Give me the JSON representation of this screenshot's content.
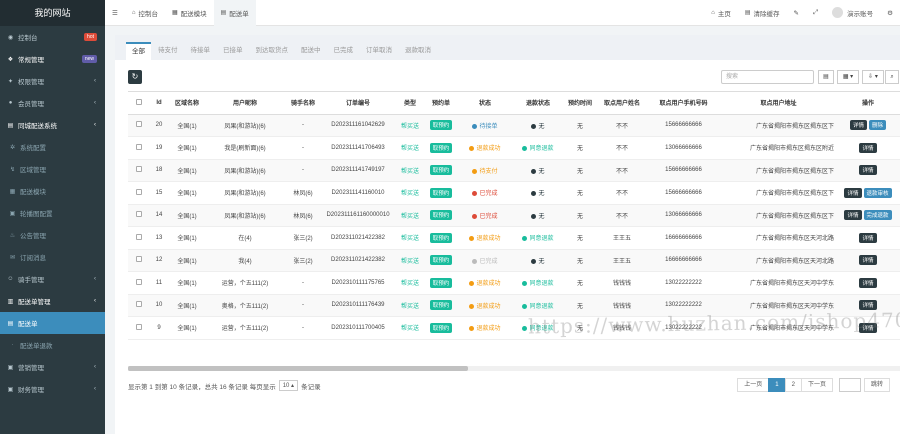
{
  "sidebar": {
    "logo": "我的网站",
    "items": [
      {
        "label": "控制台",
        "badge": "hot",
        "badge_color": "#dd4b39",
        "icon": "dashboard-icon",
        "glyph": "◉",
        "chevron": false,
        "active": false,
        "sub": false,
        "open": false
      },
      {
        "label": "常规管理",
        "badge": "new",
        "badge_color": "#605ca8",
        "icon": "cogs-icon",
        "glyph": "❖",
        "chevron": false,
        "active": false,
        "sub": false,
        "open": true
      },
      {
        "label": "权限管理",
        "badge": "",
        "icon": "group-icon",
        "glyph": "✦",
        "chevron": true,
        "active": false,
        "sub": false,
        "open": false
      },
      {
        "label": "会员管理",
        "badge": "",
        "icon": "user-icon",
        "glyph": "●",
        "chevron": true,
        "active": false,
        "sub": false,
        "open": false
      },
      {
        "label": "同城配送系统",
        "badge": "",
        "icon": "list-icon",
        "glyph": "▤",
        "chevron": true,
        "active": false,
        "sub": false,
        "open": true
      },
      {
        "label": "系统配置",
        "badge": "",
        "icon": "gear-icon",
        "glyph": "✲",
        "chevron": false,
        "active": false,
        "sub": true,
        "open": false
      },
      {
        "label": "区域管理",
        "badge": "",
        "icon": "location-icon",
        "glyph": "↯",
        "chevron": false,
        "active": false,
        "sub": true,
        "open": false
      },
      {
        "label": "配送模块",
        "badge": "",
        "icon": "module-icon",
        "glyph": "▦",
        "chevron": false,
        "active": false,
        "sub": true,
        "open": false
      },
      {
        "label": "轮播图配置",
        "badge": "",
        "icon": "image-icon",
        "glyph": "▣",
        "chevron": false,
        "active": false,
        "sub": true,
        "open": false
      },
      {
        "label": "公告管理",
        "badge": "",
        "icon": "bell-icon",
        "glyph": "♨",
        "chevron": false,
        "active": false,
        "sub": true,
        "open": false
      },
      {
        "label": "订阅消息",
        "badge": "",
        "icon": "message-icon",
        "glyph": "✉",
        "chevron": false,
        "active": false,
        "sub": true,
        "open": false
      },
      {
        "label": "骑手管理",
        "badge": "",
        "icon": "rider-icon",
        "glyph": "☺",
        "chevron": true,
        "active": false,
        "sub": false,
        "open": false
      },
      {
        "label": "配送单管理",
        "badge": "",
        "icon": "order-icon",
        "glyph": "▥",
        "chevron": true,
        "active": false,
        "sub": false,
        "open": true
      },
      {
        "label": "配送单",
        "badge": "",
        "icon": "order-list-icon",
        "glyph": "▤",
        "chevron": false,
        "active": true,
        "sub": true,
        "open": false
      },
      {
        "label": "配送单退款",
        "badge": "",
        "icon": "refund-icon",
        "glyph": "·",
        "chevron": false,
        "active": false,
        "sub": true,
        "open": false
      },
      {
        "label": "营销管理",
        "badge": "",
        "icon": "marketing-icon",
        "glyph": "▣",
        "chevron": true,
        "active": false,
        "sub": false,
        "open": false
      },
      {
        "label": "财务管理",
        "badge": "",
        "icon": "finance-icon",
        "glyph": "▣",
        "chevron": true,
        "active": false,
        "sub": false,
        "open": false
      }
    ]
  },
  "topbar": {
    "menu_icon": "☰",
    "tabs": [
      {
        "label": "控制台",
        "icon": "dashboard-icon",
        "glyph": "⌂",
        "active": false
      },
      {
        "label": "配送模块",
        "icon": "module-icon",
        "glyph": "▦",
        "active": false
      },
      {
        "label": "配送单",
        "icon": "order-list-icon",
        "glyph": "▤",
        "active": true
      }
    ],
    "right": {
      "home": "主页",
      "home_glyph": "⌂",
      "clear_cache": "清除缓存",
      "clear_glyph": "▤",
      "lang_glyph": "✎",
      "fullscreen_glyph": "⤢",
      "user": "演示账号",
      "settings_glyph": "⚙"
    }
  },
  "tabs": [
    "全部",
    "待支付",
    "待接单",
    "已接单",
    "到达取货点",
    "配送中",
    "已完成",
    "订单取消",
    "退款取消"
  ],
  "toolbar": {
    "refresh_glyph": "↻",
    "search_placeholder": "搜索",
    "toggle_glyph": "▤",
    "columns_glyph": "▦ ▾",
    "export_glyph": "⇩ ▾",
    "search_btn_glyph": "⌕"
  },
  "table": {
    "columns": [
      "Id",
      "区域名称",
      "用户昵称",
      "骑手名称",
      "订单编号",
      "类型",
      "预约单",
      "状态",
      "退款状态",
      "预约时间",
      "取点用户姓名",
      "取点用户手机号码",
      "取点用户地址",
      "操作"
    ],
    "rows": [
      {
        "id": "20",
        "area": "全国(1)",
        "user": "凤果(和游站)(6)",
        "rider": "-",
        "order_no": "D202311161042629",
        "type": "帮买送",
        "reserve": "取预约",
        "status": "待接单",
        "status_color": "#3c8dbc",
        "refund": "无",
        "refund_color": "#2c3b41",
        "time": "无",
        "taker": "不不",
        "phone": "15666666666",
        "addr": "广东省揭阳市揭东区揭东区下",
        "actions": [
          {
            "label": "详情",
            "color": "#2c3b41"
          },
          {
            "label": "删除",
            "color": "#3c8dbc"
          }
        ]
      },
      {
        "id": "19",
        "area": "全国(1)",
        "user": "我是(刷新面)(6)",
        "rider": "-",
        "order_no": "D202311141706493",
        "type": "帮买送",
        "reserve": "取预约",
        "status": "退款成功",
        "status_color": "#f39c12",
        "refund": "同意退款",
        "refund_color": "#18bc9c",
        "time": "无",
        "taker": "不不",
        "phone": "13066666666",
        "addr": "广东省揭阳市揭东区揭东区附近",
        "actions": [
          {
            "label": "详情",
            "color": "#2c3b41"
          }
        ]
      },
      {
        "id": "18",
        "area": "全国(1)",
        "user": "凤果(和游站)(6)",
        "rider": "-",
        "order_no": "D202311141749197",
        "type": "帮买送",
        "reserve": "取预约",
        "status": "待支付",
        "status_color": "#f39c12",
        "refund": "无",
        "refund_color": "#2c3b41",
        "time": "无",
        "taker": "不不",
        "phone": "15666666666",
        "addr": "广东省揭阳市揭东区揭东区下",
        "actions": [
          {
            "label": "详情",
            "color": "#2c3b41"
          }
        ]
      },
      {
        "id": "15",
        "area": "全国(1)",
        "user": "凤果(和游站)(6)",
        "rider": "林凤(6)",
        "order_no": "D202311141160010",
        "type": "帮买送",
        "reserve": "取预约",
        "status": "已完成",
        "status_color": "#dd4b39",
        "refund": "无",
        "refund_color": "#2c3b41",
        "time": "无",
        "taker": "不不",
        "phone": "15666666666",
        "addr": "广东省揭阳市揭东区揭东区下",
        "actions": [
          {
            "label": "详情",
            "color": "#2c3b41"
          },
          {
            "label": "退款审核",
            "color": "#3c8dbc"
          }
        ]
      },
      {
        "id": "14",
        "area": "全国(1)",
        "user": "凤果(和游站)(6)",
        "rider": "林凤(6)",
        "order_no": "D202311161160000010",
        "type": "帮买送",
        "reserve": "取预约",
        "status": "已完成",
        "status_color": "#dd4b39",
        "refund": "无",
        "refund_color": "#2c3b41",
        "time": "无",
        "taker": "不不",
        "phone": "13066666666",
        "addr": "广东省揭阳市揭东区揭东区下",
        "actions": [
          {
            "label": "详情",
            "color": "#2c3b41"
          },
          {
            "label": "完成退款",
            "color": "#3c8dbc"
          }
        ]
      },
      {
        "id": "13",
        "area": "全国(1)",
        "user": "在(4)",
        "rider": "张三(2)",
        "order_no": "D202311021422382",
        "type": "帮买送",
        "reserve": "取预约",
        "status": "退款成功",
        "status_color": "#f39c12",
        "refund": "同意退款",
        "refund_color": "#18bc9c",
        "time": "无",
        "taker": "王王五",
        "phone": "16666666666",
        "addr": "广东省揭阳市揭东区天河北路",
        "actions": [
          {
            "label": "详情",
            "color": "#2c3b41"
          }
        ]
      },
      {
        "id": "12",
        "area": "全国(1)",
        "user": "我(4)",
        "rider": "张三(2)",
        "order_no": "D202311021422382",
        "type": "帮买送",
        "reserve": "取预约",
        "status": "已完成",
        "status_color": "#bbb",
        "refund": "无",
        "refund_color": "#2c3b41",
        "time": "无",
        "taker": "王王五",
        "phone": "16666666666",
        "addr": "广东省揭阳市揭东区天河北路",
        "actions": [
          {
            "label": "详情",
            "color": "#2c3b41"
          }
        ]
      },
      {
        "id": "11",
        "area": "全国(1)",
        "user": "运营，个五111(2)",
        "rider": "-",
        "order_no": "D202310111175765",
        "type": "帮买送",
        "reserve": "取预约",
        "status": "退款成功",
        "status_color": "#f39c12",
        "refund": "同意退款",
        "refund_color": "#18bc9c",
        "time": "无",
        "taker": "钱钱钱",
        "phone": "13022222222",
        "addr": "广东省揭阳市揭东区天河中学东",
        "actions": [
          {
            "label": "详情",
            "color": "#2c3b41"
          }
        ]
      },
      {
        "id": "10",
        "area": "全国(1)",
        "user": "奥格，个五111(2)",
        "rider": "-",
        "order_no": "D202310111176439",
        "type": "帮买送",
        "reserve": "取预约",
        "status": "退款成功",
        "status_color": "#f39c12",
        "refund": "同意退款",
        "refund_color": "#18bc9c",
        "time": "无",
        "taker": "钱钱钱",
        "phone": "13022222222",
        "addr": "广东省揭阳市揭东区天河中学东",
        "actions": [
          {
            "label": "详情",
            "color": "#2c3b41"
          }
        ]
      },
      {
        "id": "9",
        "area": "全国(1)",
        "user": "运营，个五111(2)",
        "rider": "-",
        "order_no": "D202310111700405",
        "type": "帮买送",
        "reserve": "取预约",
        "status": "退款成功",
        "status_color": "#f39c12",
        "refund": "同意退款",
        "refund_color": "#18bc9c",
        "time": "无",
        "taker": "钱钱钱",
        "phone": "13022222222",
        "addr": "广东省揭阳市揭东区天河中学东",
        "actions": [
          {
            "label": "详情",
            "color": "#2c3b41"
          }
        ]
      }
    ]
  },
  "footer": {
    "info_prefix": "显示第 1 到第 10 条记录，总共 16 条记录 每页显示",
    "page_size": "10 ▴",
    "info_suffix": "条记录",
    "prev": "上一页",
    "pages": [
      "1",
      "2"
    ],
    "current_page": "1",
    "next": "下一页",
    "jump": "跳转"
  },
  "watermark": "https://www.huzhan.com/ishop47020",
  "colors": {
    "accent": "#3c8dbc",
    "sidebar_bg": "#2c3b41",
    "success": "#18bc9c"
  }
}
